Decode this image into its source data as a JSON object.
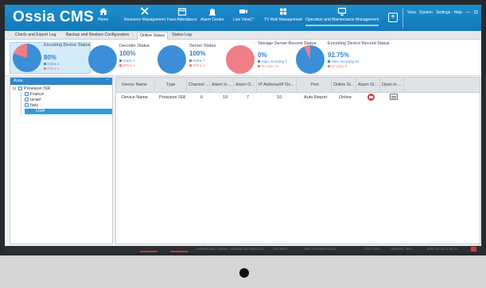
{
  "app": {
    "title": "Ossia CMS"
  },
  "nav": [
    {
      "label": "Home",
      "icon": "home-icon"
    },
    {
      "label": "Resource Management",
      "icon": "tools-icon"
    },
    {
      "label": "Face Attendance",
      "icon": "calendar-icon"
    },
    {
      "label": "Alarm Center",
      "icon": "alarm-icon"
    },
    {
      "label": "Live View1*",
      "icon": "camera-icon"
    },
    {
      "label": "TV Wall Management",
      "icon": "grid-icon"
    },
    {
      "label": "Operation and Maintenance Management",
      "icon": "monitor-icon"
    }
  ],
  "top_links": [
    "View",
    "System",
    "Settings",
    "Help"
  ],
  "window_controls": {
    "minimize": "—",
    "restore": "⊡",
    "close": "✕"
  },
  "tabs": [
    "Check and Export Log",
    "Backup and Restore Configuration",
    "Online Status",
    "Status Log"
  ],
  "status_cards": [
    {
      "title": "Encoding Device Status",
      "pct": "80%",
      "leg1": "Online 4",
      "leg2": "Offline 1",
      "fraction": 0.8
    },
    {
      "title": "Decoder Status",
      "pct": "100%",
      "leg1": "Online 1",
      "leg2": "Offline 0",
      "fraction": 1.0
    },
    {
      "title": "Server Status",
      "pct": "100%",
      "leg1": "Online 7",
      "leg2": "Offline 0",
      "fraction": 1.0
    },
    {
      "title": "Storage Server Record Status",
      "pct": "0%",
      "leg1": "Video recording 0",
      "leg2": "No video 72",
      "fraction": 0.0
    },
    {
      "title": "Encoding Device Record Status",
      "pct": "92.75%",
      "leg1": "Video recording 64",
      "leg2": "No video 5",
      "fraction": 0.9275
    }
  ],
  "area_panel": {
    "title": "Area",
    "root": "Provision ISR",
    "children": [
      "France",
      "Israel",
      "Italy",
      "USA"
    ],
    "selected": "USA"
  },
  "table": {
    "headers": [
      "Device Name",
      "Type",
      "Channel ...",
      "Alarm In ...",
      "Alarm O...",
      "IP Address/IP Do...",
      "Port",
      "Online St...",
      "Alarm St...",
      "Open in ..."
    ],
    "rows": [
      {
        "device_name": "Device Name",
        "type": "Provision ISR",
        "channel": "6",
        "alarm_in": "19",
        "alarm_out": "7",
        "ip": "10",
        "port": "Auto Report",
        "online": "Online"
      }
    ]
  },
  "status_bar": {
    "auth_server": "Authentication Server : Address 192.168.0.212",
    "port": "Port:6003",
    "user": "User: ProvisionAdmin",
    "cpu": "CPU: 13%",
    "memory": "Memory: 39%",
    "datetime": "2021-02-16 11:46:41"
  },
  "colors": {
    "header": "#1b8fd0",
    "online": "#3c8fd6",
    "offline": "#f07e86",
    "selected_row": "#2f9be0"
  }
}
